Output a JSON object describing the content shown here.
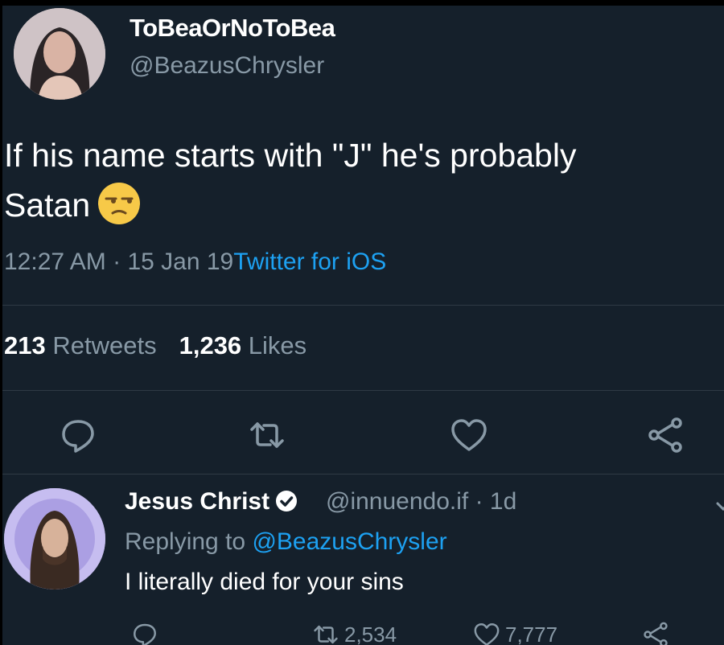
{
  "tweet": {
    "display_name": "ToBeaOrNoToBea",
    "handle": "@BeazusChrysler",
    "text_line1": "If his name starts with \"J\" he's probably",
    "text_line2": "Satan",
    "emoji": "unamused-face-emoji",
    "time": "12:27 AM",
    "separator": "·",
    "date": "15 Jan 19",
    "source": "Twitter for iOS",
    "retweets_count": "213",
    "retweets_label": "Retweets",
    "likes_count": "1,236",
    "likes_label": "Likes",
    "actions": [
      "reply-icon",
      "retweet-icon",
      "like-icon",
      "share-icon"
    ]
  },
  "reply": {
    "display_name": "Jesus Christ",
    "verified": true,
    "handle_time": "@innuendo.if · 1d",
    "replying_prefix": "Replying to",
    "replying_to": "@BeazusChrysler",
    "text": "I literally died for your sins",
    "retweets_count": "2,534",
    "likes_count": "7,777"
  },
  "colors": {
    "background": "#15202b",
    "accent": "#1da1f2",
    "secondary_text": "#8899a6",
    "primary_text": "#ffffff"
  }
}
